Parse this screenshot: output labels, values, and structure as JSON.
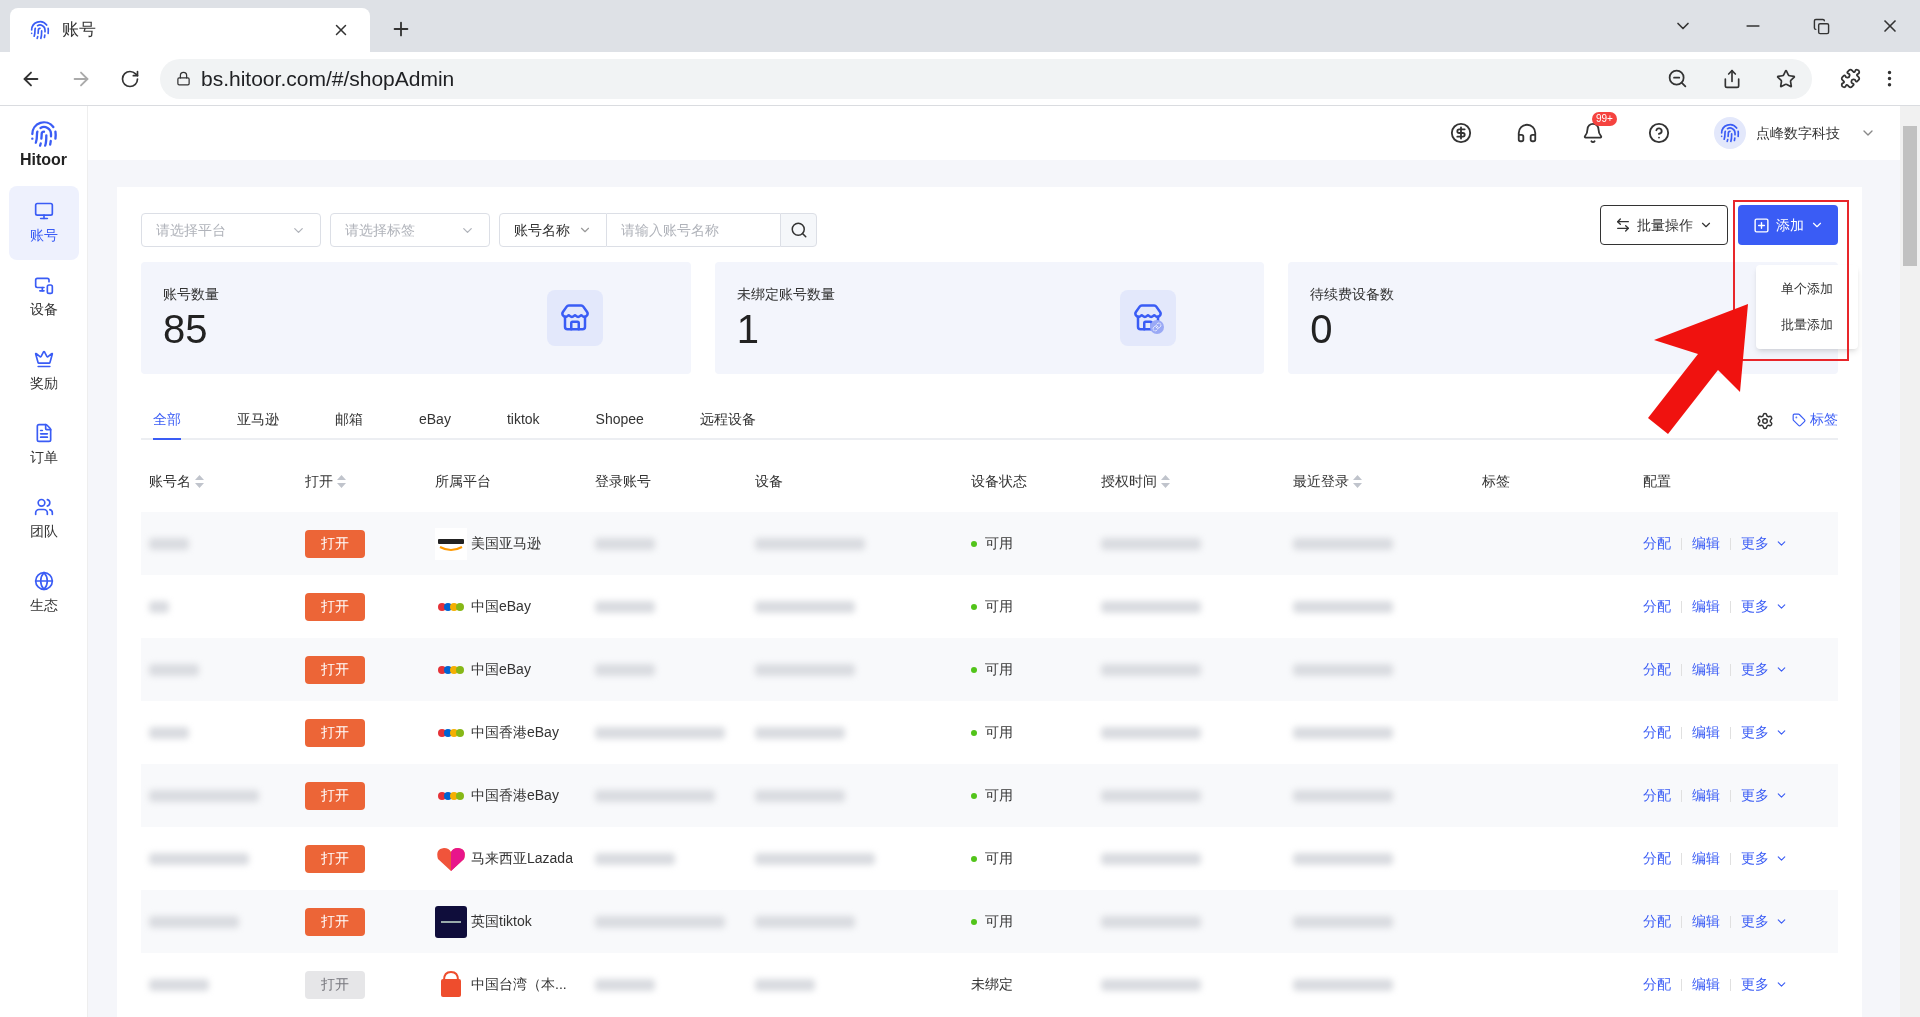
{
  "browser": {
    "tab_title": "账号",
    "url": "bs.hitoor.com/#/shopAdmin"
  },
  "header": {
    "notification_badge": "99+",
    "user_name": "点峰数字科技"
  },
  "sidebar": {
    "logo_text": "Hitoor",
    "items": [
      {
        "label": "账号",
        "selected": true
      },
      {
        "label": "设备",
        "selected": false
      },
      {
        "label": "奖励",
        "selected": false
      },
      {
        "label": "订单",
        "selected": false
      },
      {
        "label": "团队",
        "selected": false
      },
      {
        "label": "生态",
        "selected": false
      }
    ]
  },
  "filters": {
    "platform_placeholder": "请选择平台",
    "tag_placeholder": "请选择标签",
    "field_select": "账号名称",
    "search_placeholder": "请输入账号名称"
  },
  "actions": {
    "batch": "批量操作",
    "add": "添加",
    "add_menu": [
      "单个添加",
      "批量添加"
    ]
  },
  "stats": [
    {
      "label": "账号数量",
      "value": "85"
    },
    {
      "label": "未绑定账号数量",
      "value": "1"
    },
    {
      "label": "待续费设备数",
      "value": "0"
    }
  ],
  "tabs": [
    {
      "label": "全部",
      "selected": true
    },
    {
      "label": "亚马逊",
      "selected": false
    },
    {
      "label": "邮箱",
      "selected": false
    },
    {
      "label": "eBay",
      "selected": false
    },
    {
      "label": "tiktok",
      "selected": false
    },
    {
      "label": "Shopee",
      "selected": false
    },
    {
      "label": "远程设备",
      "selected": false
    }
  ],
  "tag_link": "标签",
  "table": {
    "columns": [
      {
        "label": "账号名",
        "sortable": true
      },
      {
        "label": "打开",
        "sortable": true
      },
      {
        "label": "所属平台",
        "sortable": false
      },
      {
        "label": "登录账号",
        "sortable": false
      },
      {
        "label": "设备",
        "sortable": false
      },
      {
        "label": "设备状态",
        "sortable": false
      },
      {
        "label": "授权时间",
        "sortable": true
      },
      {
        "label": "最近登录",
        "sortable": true
      },
      {
        "label": "标签",
        "sortable": false
      },
      {
        "label": "配置",
        "sortable": false
      }
    ],
    "rows": [
      {
        "open": "打开",
        "open_disabled": false,
        "kind": "amazon",
        "platform": "美国亚马逊",
        "status": "可用",
        "available": true,
        "actions": [
          "分配",
          "编辑",
          "更多"
        ]
      },
      {
        "open": "打开",
        "open_disabled": false,
        "kind": "ebay",
        "platform": "中国eBay",
        "status": "可用",
        "available": true,
        "actions": [
          "分配",
          "编辑",
          "更多"
        ]
      },
      {
        "open": "打开",
        "open_disabled": false,
        "kind": "ebay",
        "platform": "中国eBay",
        "status": "可用",
        "available": true,
        "actions": [
          "分配",
          "编辑",
          "更多"
        ]
      },
      {
        "open": "打开",
        "open_disabled": false,
        "kind": "ebay",
        "platform": "中国香港eBay",
        "status": "可用",
        "available": true,
        "actions": [
          "分配",
          "编辑",
          "更多"
        ]
      },
      {
        "open": "打开",
        "open_disabled": false,
        "kind": "ebay",
        "platform": "中国香港eBay",
        "status": "可用",
        "available": true,
        "actions": [
          "分配",
          "编辑",
          "更多"
        ]
      },
      {
        "open": "打开",
        "open_disabled": false,
        "kind": "lazada",
        "platform": "马来西亚Lazada",
        "status": "可用",
        "available": true,
        "actions": [
          "分配",
          "编辑",
          "更多"
        ]
      },
      {
        "open": "打开",
        "open_disabled": false,
        "kind": "tiktok",
        "platform": "英国tiktok",
        "status": "可用",
        "available": true,
        "actions": [
          "分配",
          "编辑",
          "更多"
        ]
      },
      {
        "open": "打开",
        "open_disabled": true,
        "kind": "shopee",
        "platform": "中国台湾（本...",
        "status": "未绑定",
        "available": false,
        "actions": [
          "分配",
          "编辑",
          "更多"
        ]
      }
    ]
  }
}
